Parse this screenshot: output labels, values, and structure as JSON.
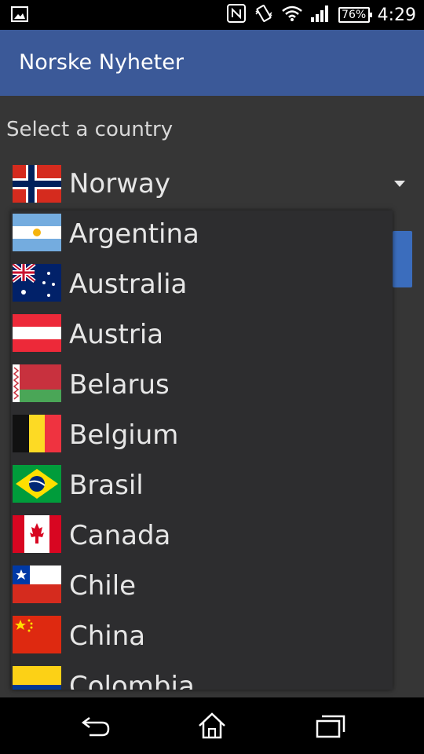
{
  "status_bar": {
    "battery": "76%",
    "time": "4:29"
  },
  "app_bar": {
    "title": "Norske Nyheter"
  },
  "content": {
    "label": "Select a country",
    "selected_country": "Norway"
  },
  "dropdown": {
    "items": [
      {
        "label": "Argentina",
        "flag": "flag-argentina"
      },
      {
        "label": "Australia",
        "flag": "flag-australia"
      },
      {
        "label": "Austria",
        "flag": "flag-austria"
      },
      {
        "label": "Belarus",
        "flag": "flag-belarus"
      },
      {
        "label": "Belgium",
        "flag": "flag-belgium"
      },
      {
        "label": "Brasil",
        "flag": "flag-brazil"
      },
      {
        "label": "Canada",
        "flag": "flag-canada"
      },
      {
        "label": "Chile",
        "flag": "flag-chile"
      },
      {
        "label": "China",
        "flag": "flag-china"
      },
      {
        "label": "Colombia",
        "flag": "flag-colombia"
      }
    ]
  },
  "colors": {
    "app_bar": "#3b5998",
    "content_bg": "#363636",
    "dropdown_bg": "#2d2d2f",
    "text": "#e6e6e6"
  }
}
